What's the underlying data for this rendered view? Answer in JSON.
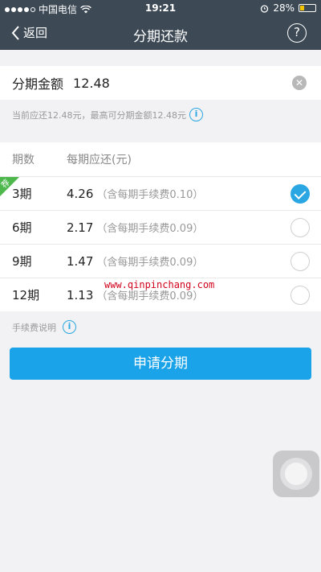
{
  "status_bar": {
    "carrier": "中国电信",
    "time": "19:21",
    "battery": "28%",
    "battery_level": 0.28
  },
  "nav": {
    "back_label": "返回",
    "title": "分期还款",
    "help_label": "?"
  },
  "amount": {
    "label": "分期金额",
    "value": "12.48"
  },
  "info": {
    "text": "当前应还12.48元，最高可分期金额12.48元",
    "icon_label": "i"
  },
  "plans": {
    "header_period": "期数",
    "header_amount": "每期应还(元)",
    "recommend_tag": "荐",
    "rows": [
      {
        "period": "3期",
        "amount": "4.26",
        "fee": "（含每期手续费0.10）",
        "selected": true
      },
      {
        "period": "6期",
        "amount": "2.17",
        "fee": "（含每期手续费0.09）",
        "selected": false
      },
      {
        "period": "9期",
        "amount": "1.47",
        "fee": "（含每期手续费0.09）",
        "selected": false
      },
      {
        "period": "12期",
        "amount": "1.13",
        "fee": "（含每期手续费0.09）",
        "selected": false
      }
    ]
  },
  "watermark": "www.qinpinchang.com",
  "fee_note": {
    "label": "手续费说明",
    "icon_label": "i"
  },
  "apply_button": "申请分期",
  "colors": {
    "navbar": "#3d4a56",
    "accent": "#1aa3e8",
    "recommend": "#4cb84c"
  }
}
